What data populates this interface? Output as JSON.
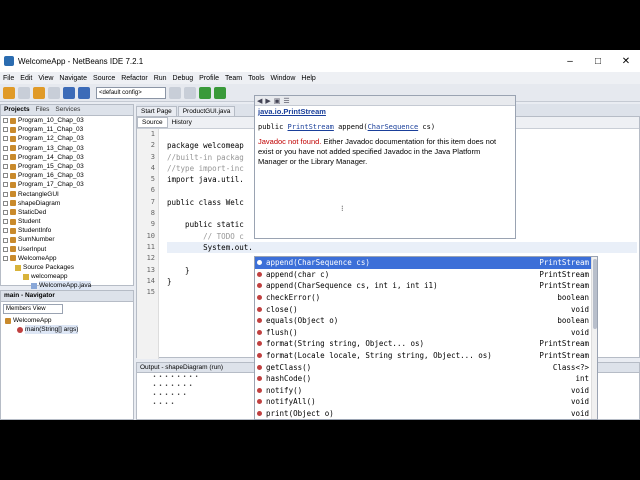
{
  "window": {
    "title": "WelcomeApp - NetBeans IDE 7.2.1"
  },
  "menu": [
    "File",
    "Edit",
    "View",
    "Navigate",
    "Source",
    "Refactor",
    "Run",
    "Debug",
    "Profile",
    "Team",
    "Tools",
    "Window",
    "Help"
  ],
  "toolbar": {
    "config": "<default config>"
  },
  "projects": {
    "tabs": [
      "Projects",
      "Files",
      "Services"
    ],
    "items": [
      "Program_10_Chap_03",
      "Program_11_Chap_03",
      "Program_12_Chap_03",
      "Program_13_Chap_03",
      "Program_14_Chap_03",
      "Program_15_Chap_03",
      "Program_16_Chap_03",
      "Program_17_Chap_03",
      "RectangleGUI",
      "shapeDiagram",
      "StaticDed",
      "Student",
      "StudentInfo",
      "SumNumber",
      "UserInput",
      "WelcomeApp"
    ],
    "sub": {
      "source_packages": "Source Packages",
      "package": "welcomeapp",
      "file": "WelcomeApp.java"
    }
  },
  "navigator": {
    "title": "main - Navigator",
    "select": "Members View",
    "root": "WelcomeApp",
    "member": "main(String[] args)"
  },
  "editor": {
    "tabs": [
      "Start Page",
      "ProductGUI.java"
    ],
    "modes": [
      "Source",
      "History"
    ],
    "line_numbers": [
      "1",
      "2",
      "3",
      "4",
      "5",
      "6",
      "7",
      "8",
      "9",
      "10",
      "11",
      "12",
      "13",
      "14",
      "15"
    ],
    "lines": [
      "",
      "package welcomeap",
      "//built-in packag",
      "//type import-inc",
      "import java.util.",
      "",
      "public class Welc",
      "",
      "    public static",
      "        // TODO c",
      "        System.out.",
      "",
      "    }",
      "}",
      ""
    ]
  },
  "output": {
    "title": "Output - shapeDiagram (run)"
  },
  "javadoc": {
    "class_link": "java.io.PrintStream",
    "sig_pre": "public ",
    "sig_type": "PrintStream",
    "sig_mid": " append(",
    "sig_param": "CharSequence",
    "sig_post": " cs)",
    "msg_red": "Javadoc not found.",
    "msg_rest": " Either Javadoc documentation for this item does not exist or you have not added specified Javadoc in the Java Platform Manager or the Library Manager."
  },
  "completion": [
    {
      "sig": "append(CharSequence cs)",
      "ret": "PrintStream"
    },
    {
      "sig": "append(char c)",
      "ret": "PrintStream"
    },
    {
      "sig": "append(CharSequence cs, int i, int i1)",
      "ret": "PrintStream"
    },
    {
      "sig": "checkError()",
      "ret": "boolean"
    },
    {
      "sig": "close()",
      "ret": "void"
    },
    {
      "sig": "equals(Object o)",
      "ret": "boolean"
    },
    {
      "sig": "flush()",
      "ret": "void"
    },
    {
      "sig": "format(String string, Object... os)",
      "ret": "PrintStream"
    },
    {
      "sig": "format(Locale locale, String string, Object... os)",
      "ret": "PrintStream"
    },
    {
      "sig": "getClass()",
      "ret": "Class<?>"
    },
    {
      "sig": "hashCode()",
      "ret": "int"
    },
    {
      "sig": "notify()",
      "ret": "void"
    },
    {
      "sig": "notifyAll()",
      "ret": "void"
    },
    {
      "sig": "print(Object o)",
      "ret": "void"
    }
  ]
}
